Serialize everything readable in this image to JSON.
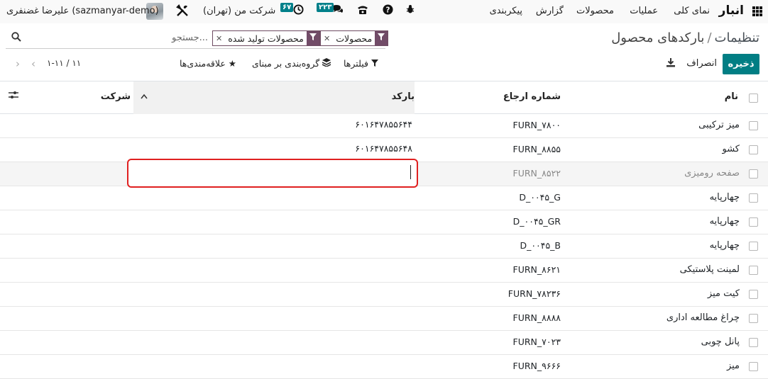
{
  "navbar": {
    "app_name": "انبار",
    "menu": [
      "نمای کلی",
      "عملیات",
      "محصولات",
      "گزارش",
      "پیکربندی"
    ],
    "company": "شرکت من (تهران)",
    "user": "علیرضا غضنفری (sazmanyar-demo)",
    "activity_count": "۶۷",
    "messages_count": "۲۲۳",
    "icons": [
      "apps-grid-icon",
      "bug-icon",
      "help-icon",
      "phone-icon",
      "chat-icon",
      "clock-icon",
      "tools-icon"
    ]
  },
  "breadcrumb": {
    "parent": "تنظیمات",
    "separator": "/",
    "current": "بارکدهای محصول"
  },
  "search": {
    "facets": [
      {
        "label": "محصولات"
      },
      {
        "label": "محصولات تولید شده"
      }
    ],
    "placeholder": "جستجو..."
  },
  "actions": {
    "save": "ذخیره",
    "discard": "انصراف"
  },
  "toolbar": {
    "filters": "فیلترها",
    "group_by": "گروه‌بندی بر مبنای",
    "favorites": "علاقه‌مندی‌ها"
  },
  "pager": {
    "value": "۱-۱۱ / ۱۱"
  },
  "table": {
    "columns": {
      "name": "نام",
      "reference": "شماره ارجاع",
      "barcode": "بارکد",
      "company": "شرکت"
    },
    "rows": [
      {
        "name": "میز ترکیبی",
        "ref": "FURN_۷۸۰۰",
        "barcode": "۶۰۱۶۴۷۸۵۵۶۴۴"
      },
      {
        "name": "کشو",
        "ref": "FURN_۸۸۵۵",
        "barcode": "۶۰۱۶۴۷۸۵۵۶۴۸"
      },
      {
        "name": "صفحه رومیزی",
        "ref": "FURN_۸۵۲۲",
        "barcode": ""
      },
      {
        "name": "چهارپایه",
        "ref": "D_۰۰۴۵_G",
        "barcode": ""
      },
      {
        "name": "چهارپایه",
        "ref": "D_۰۰۴۵_GR",
        "barcode": ""
      },
      {
        "name": "چهارپایه",
        "ref": "D_۰۰۴۵_B",
        "barcode": ""
      },
      {
        "name": "لمینت پلاستیکی",
        "ref": "FURN_۸۶۲۱",
        "barcode": ""
      },
      {
        "name": "کیت میز",
        "ref": "FURN_۷۸۲۳۶",
        "barcode": ""
      },
      {
        "name": "چراغ مطالعه اداری",
        "ref": "FURN_۸۸۸۸",
        "barcode": ""
      },
      {
        "name": "پانل چوبی",
        "ref": "FURN_۷۰۲۳",
        "barcode": ""
      },
      {
        "name": "میز",
        "ref": "FURN_۹۶۶۶",
        "barcode": ""
      }
    ]
  },
  "colors": {
    "primary": "#017e84",
    "facet": "#714b67",
    "badge": "#00808a",
    "edit_outline": "#e02020"
  }
}
